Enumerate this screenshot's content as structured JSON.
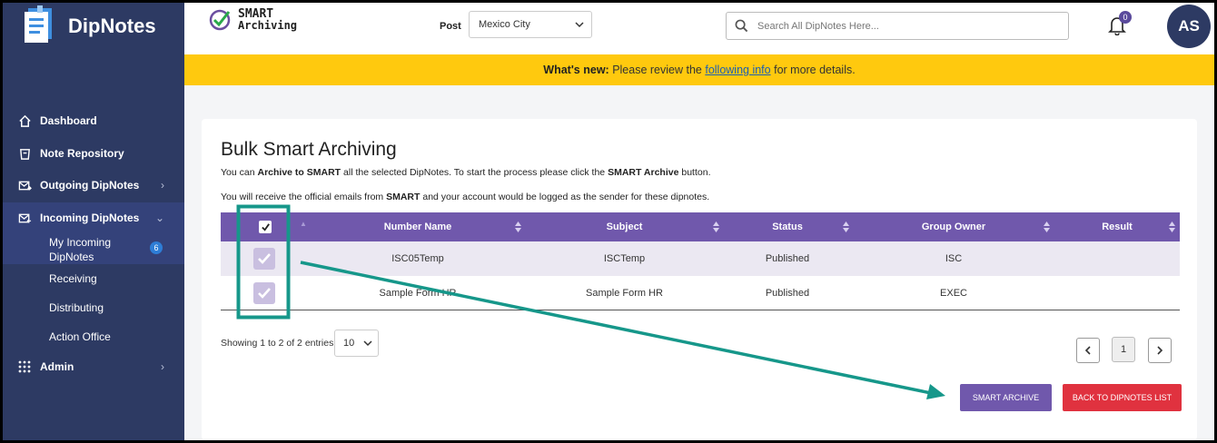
{
  "app": {
    "name": "DipNotes"
  },
  "sidebar": {
    "items": [
      {
        "label": "Dashboard",
        "icon": "home-icon"
      },
      {
        "label": "Note Repository",
        "icon": "repository-icon"
      },
      {
        "label": "Outgoing DipNotes",
        "icon": "mail-outgoing-icon"
      },
      {
        "label": "Incoming DipNotes",
        "icon": "mail-incoming-icon"
      },
      {
        "label": "Admin",
        "icon": "grid-icon"
      }
    ],
    "subitems": [
      {
        "label": "My Incoming DipNotes",
        "badge": "6"
      },
      {
        "label": "Receiving"
      },
      {
        "label": "Distributing"
      },
      {
        "label": "Action Office"
      }
    ]
  },
  "header": {
    "module_line1": "SMART",
    "module_line2": "Archiving",
    "post_label": "Post",
    "post_value": "Mexico City",
    "search_placeholder": "Search All DipNotes Here...",
    "notification_count": "0",
    "avatar_initials": "AS"
  },
  "announcement": {
    "lead": "What's new:",
    "text_before": "Please review the",
    "link": "following info",
    "text_after": "for more details."
  },
  "main": {
    "title": "Bulk Smart Archiving",
    "desc1": {
      "a": "You can",
      "b": "Archive to SMART",
      "c": "all the selected DipNotes. To start the process please click the",
      "d": "SMART Archive",
      "e": "button."
    },
    "desc2": {
      "a": "You will receive the official emails from",
      "b": "SMART",
      "c": "and your account would be logged as the sender for these dipnotes."
    },
    "table": {
      "columns": [
        "Number Name",
        "Subject",
        "Status",
        "Group Owner",
        "Result"
      ],
      "rows": [
        {
          "number_name": "ISC05Temp",
          "subject": "ISCTemp",
          "status": "Published",
          "group_owner": "ISC",
          "result": ""
        },
        {
          "number_name": "Sample Form HR",
          "subject": "Sample Form HR",
          "status": "Published",
          "group_owner": "EXEC",
          "result": ""
        }
      ]
    },
    "showing": "Showing 1 to 2 of 2 entries",
    "page_size": "10",
    "current_page": "1",
    "buttons": {
      "smart_archive": "SMART ARCHIVE",
      "back": "BACK TO DIPNOTES LIST"
    }
  },
  "colors": {
    "sidebar": "#2d3a63",
    "accent_purple": "#7058ac",
    "banner": "#ffc90e",
    "danger": "#e0323f",
    "annotation": "#16978a"
  }
}
